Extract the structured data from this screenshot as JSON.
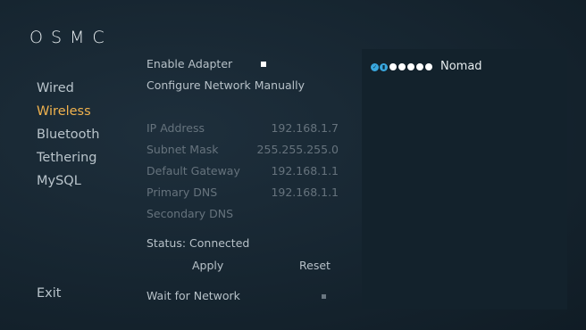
{
  "app": {
    "logo_text": "OSMC"
  },
  "sidebar": {
    "items": [
      {
        "label": "Wired"
      },
      {
        "label": "Wireless"
      },
      {
        "label": "Bluetooth"
      },
      {
        "label": "Tethering"
      },
      {
        "label": "MySQL"
      }
    ],
    "active_index": 1,
    "exit_label": "Exit"
  },
  "settings": {
    "enable_adapter_label": "Enable Adapter",
    "enable_adapter_checked": true,
    "configure_manually_label": "Configure Network Manually",
    "ip_label": "IP Address",
    "ip_value": "192.168.1.7",
    "subnet_label": "Subnet Mask",
    "subnet_value": "255.255.255.0",
    "gateway_label": "Default Gateway",
    "gateway_value": "192.168.1.1",
    "primary_dns_label": "Primary DNS",
    "primary_dns_value": "192.168.1.1",
    "secondary_dns_label": "Secondary DNS",
    "secondary_dns_value": "",
    "status_text": "Status: Connected",
    "apply_label": "Apply",
    "reset_label": "Reset",
    "wait_for_network_label": "Wait for Network",
    "wait_for_network_checked": false
  },
  "networks": [
    {
      "name": "Nomad",
      "connected_icon": "check-icon",
      "secured_icon": "lock-icon",
      "signal_dots": 5,
      "signal_strength": 5
    }
  ],
  "colors": {
    "accent": "#f0b24e",
    "icon_blue": "#39a7de",
    "background": "#162530",
    "panel": "#13222c"
  }
}
